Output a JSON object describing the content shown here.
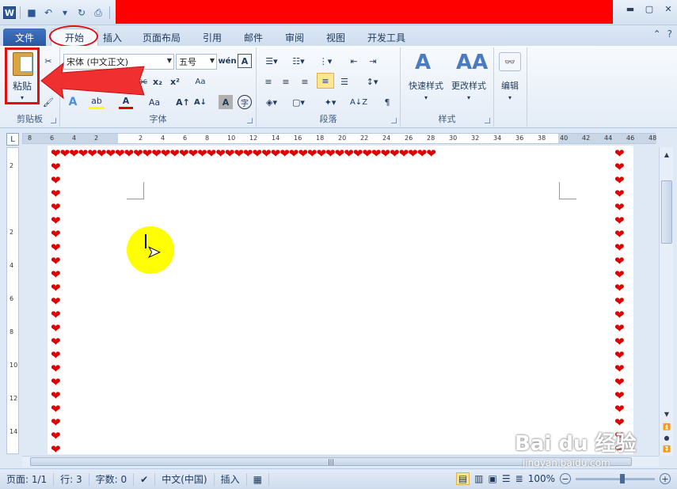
{
  "qat": {
    "word_logo": "W",
    "icons": [
      "save-icon",
      "undo-icon",
      "redo-icon",
      "print-preview-icon",
      "customize-icon"
    ]
  },
  "window_controls": [
    "minimize-icon",
    "maximize-icon",
    "close-icon"
  ],
  "tabs": [
    "文件",
    "开始",
    "插入",
    "页面布局",
    "引用",
    "邮件",
    "审阅",
    "视图",
    "开发工具"
  ],
  "tab_right_icons": [
    "help-icon"
  ],
  "ribbon": {
    "clipboard": {
      "paste": "粘贴",
      "label": "剪贴板"
    },
    "font": {
      "font_name": "宋体 (中文正文)",
      "font_size": "五号",
      "label": "字体"
    },
    "paragraph": {
      "label": "段落"
    },
    "styles": {
      "quick": "快速样式",
      "change": "更改样式",
      "label": "样式"
    },
    "editing": {
      "edit": "编辑"
    }
  },
  "ruler_h_ticks": [
    "8",
    "6",
    "4",
    "2",
    "",
    "2",
    "4",
    "6",
    "8",
    "10",
    "12",
    "14",
    "16",
    "18",
    "20",
    "22",
    "24",
    "26",
    "28",
    "30",
    "32",
    "34",
    "36",
    "38",
    "40",
    "42",
    "44",
    "46",
    "48"
  ],
  "ruler_v_ticks": [
    "2",
    "",
    "2",
    "4",
    "6",
    "8",
    "10",
    "12",
    "14"
  ],
  "status": {
    "page": "页面: 1/1",
    "line": "行: 3",
    "words": "字数: 0",
    "language": "中文(中国)",
    "mode": "插入",
    "zoom": "100%"
  },
  "watermark": {
    "main": "Bai du 经验",
    "sub": "jingyan.baidu.com"
  },
  "colors": {
    "accent": "#2b5797",
    "title_band": "#ff0000",
    "annotation": "#e01010",
    "border_heart": "#e00000",
    "cursor_highlight": "#ffff00"
  }
}
